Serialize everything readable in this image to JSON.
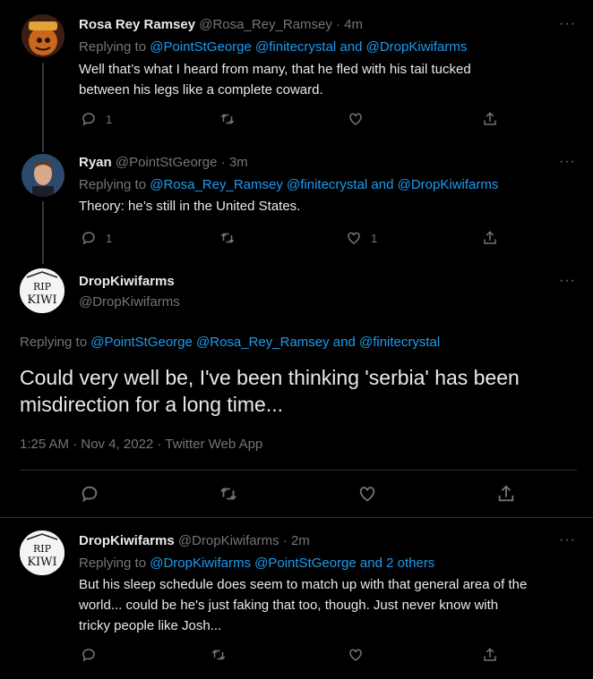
{
  "tweets": [
    {
      "name": "Rosa Rey Ramsey",
      "handle": "@Rosa_Rey_Ramsey",
      "time": "· 4m",
      "replying_prefix": "Replying to ",
      "replying_targets": "@PointStGeorge @finitecrystal and @DropKiwifarms",
      "text_lines": [
        "Well that’s what I heard from many, that he fled with his tail tucked",
        "between his legs like a complete coward."
      ],
      "reply_count": "1",
      "like_count": ""
    },
    {
      "name": "Ryan",
      "handle": "@PointStGeorge",
      "time": "· 3m",
      "replying_prefix": "Replying to ",
      "replying_targets": "@Rosa_Rey_Ramsey @finitecrystal and @DropKiwifarms",
      "text_lines": [
        "Theory: he’s still in the United States."
      ],
      "reply_count": "1",
      "like_count": "1"
    }
  ],
  "main_tweet": {
    "name": "DropKiwifarms",
    "handle": "@DropKiwifarms",
    "replying_prefix": "Replying to ",
    "replying_targets": "@PointStGeorge @Rosa_Rey_Ramsey and @finitecrystal",
    "text_lines": [
      "Could very well be, I've been thinking 'serbia' has been",
      "misdirection for a long time..."
    ],
    "meta": "1:25 AM · Nov 4, 2022 · Twitter Web App"
  },
  "reply_tweet": {
    "name": "DropKiwifarms",
    "handle": "@DropKiwifarms",
    "time": "· 2m",
    "replying_prefix": "Replying to ",
    "replying_targets": "@DropKiwifarms @PointStGeorge and 2 others",
    "text_lines": [
      "But his sleep schedule does seem to match up with that general area of the",
      "world... could be he's just faking that too, though. Just never know with",
      "tricky people like Josh..."
    ]
  },
  "avatar_text": {
    "rip": "RIP",
    "kiwi": "KIWI"
  },
  "more_label": "···",
  "colors": {
    "background": "#000000",
    "text": "#e7e9ea",
    "muted": "#71767b",
    "link": "#1d9bf0",
    "divider": "#2f3336"
  }
}
